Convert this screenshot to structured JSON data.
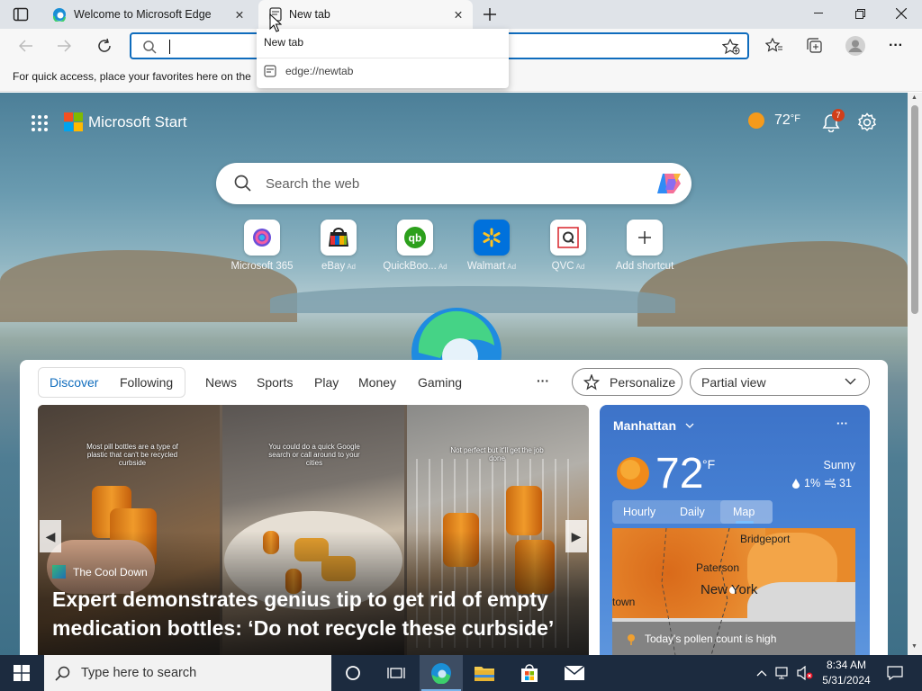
{
  "browser": {
    "tabs": [
      {
        "label": "Welcome to Microsoft Edge"
      },
      {
        "label": "New tab"
      }
    ],
    "address_value": "",
    "favorites_hint": "For quick access, place your favorites here on the",
    "suggestions": [
      {
        "label": "New tab"
      },
      {
        "label": "edge://newtab"
      }
    ]
  },
  "newtab": {
    "brand": "Microsoft Start",
    "weather_top": {
      "temp": "72",
      "unit": "°F"
    },
    "notification_count": "7",
    "search_placeholder": "Search the web",
    "shortcuts": [
      {
        "name": "Microsoft 365",
        "ad": ""
      },
      {
        "name": "eBay",
        "ad": "Ad"
      },
      {
        "name": "QuickBoo...",
        "ad": "Ad"
      },
      {
        "name": "Walmart",
        "ad": "Ad"
      },
      {
        "name": "QVC",
        "ad": "Ad"
      },
      {
        "name": "Add shortcut",
        "ad": ""
      }
    ]
  },
  "feed": {
    "tabs": [
      "Discover",
      "Following",
      "News",
      "Sports",
      "Play",
      "Money",
      "Gaming"
    ],
    "more": "···",
    "personalize": "Personalize",
    "view_select": "Partial view",
    "hero": {
      "captions": [
        "Most pill bottles are a type of plastic that can't be recycled curbside",
        "You could do a quick Google search or call around to your cities",
        "Not perfect but it'll get the job done"
      ],
      "source": "The Cool Down",
      "headline": "Expert demonstrates genius tip to get rid of empty medication bottles: ‘Do not recycle these curbside’"
    }
  },
  "weather": {
    "location": "Manhattan",
    "more": "···",
    "temp": "72",
    "unit": "°F",
    "condition": "Sunny",
    "precip": "1%",
    "wind": "31",
    "tabs": [
      "Hourly",
      "Daily",
      "Map"
    ],
    "map_labels": [
      "Bridgeport",
      "Paterson",
      "New York",
      "town"
    ],
    "pollen": "Today's pollen count is high"
  },
  "taskbar": {
    "search_placeholder": "Type here to search",
    "time": "8:34 AM",
    "date": "5/31/2024"
  }
}
